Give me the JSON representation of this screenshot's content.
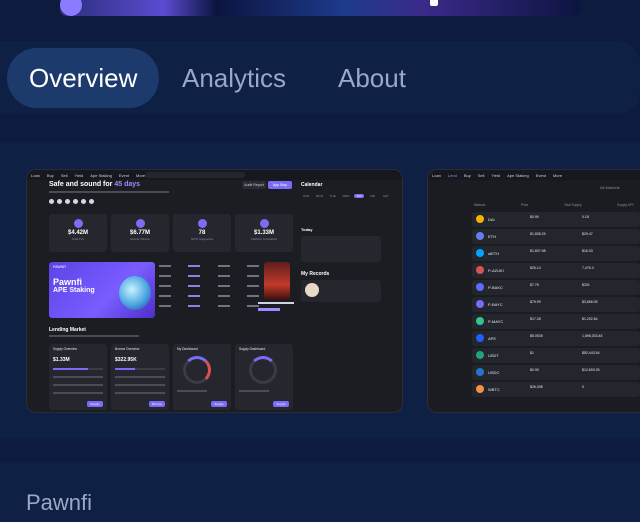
{
  "tabs": [
    {
      "label": "Overview",
      "active": true
    },
    {
      "label": "Analytics",
      "active": false
    },
    {
      "label": "About",
      "active": false
    }
  ],
  "project": {
    "name": "Pawnfi"
  },
  "screenshot_1": {
    "nav": [
      "Loan",
      "Buy",
      "Sell",
      "Yield",
      "Ape Staking",
      "Event",
      "More"
    ],
    "headline": "Safe and sound for",
    "headline_days": "45 days",
    "buttons": {
      "audit": "Audit Report",
      "app": "App Stop"
    },
    "stats": [
      {
        "value": "$4.42M",
        "label": "Total TVL"
      },
      {
        "value": "$6.77M",
        "label": "Assets Volume"
      },
      {
        "value": "78",
        "label": "NFTs Supported"
      },
      {
        "value": "$1.33M",
        "label": "Platform Circulation"
      }
    ],
    "banner": {
      "brand": "PAWNFI",
      "line1": "Pawnfi",
      "line2": "APE Staking"
    },
    "calendar": {
      "title": "Calendar",
      "year": "2023",
      "days": [
        "SUN",
        "MON",
        "TUE",
        "WED",
        "THU",
        "FRI",
        "SAT"
      ],
      "selected": "Thu"
    },
    "today_label": "Today",
    "records_title": "My Records",
    "lending": {
      "title": "Lending Market",
      "cards": [
        {
          "title": "Supply Overview",
          "value": "$1.33M",
          "button": "Supply"
        },
        {
          "title": "Borrow Overview",
          "value": "$322.95K",
          "button": "Borrow"
        },
        {
          "title": "My Dashboard",
          "value": "",
          "button": "Supply"
        },
        {
          "title": "Supply Dashboard",
          "value": "",
          "button": "Supply"
        }
      ]
    }
  },
  "screenshot_2": {
    "nav": [
      "Loan",
      "Lend",
      "Buy",
      "Sell",
      "Yield",
      "Ape Staking",
      "Event",
      "More"
    ],
    "all_markets": "All Markets",
    "columns": [
      "Markets",
      "Price",
      "Total Supply",
      "Supply APY"
    ],
    "rows": [
      {
        "sym": "DAI",
        "price": "$0.99",
        "supply": "0.18",
        "color": "#f5b300"
      },
      {
        "sym": "ETH",
        "price": "$1,838.25",
        "supply": "$29.47",
        "color": "#627eea"
      },
      {
        "sym": "stETH",
        "price": "$1,837.98",
        "supply": "$16.33",
        "color": "#00a3ff"
      },
      {
        "sym": "P-AZUKI",
        "price": "$26.14",
        "supply": "7,476.4",
        "color": "#d9534f"
      },
      {
        "sym": "P-BAKC",
        "price": "$7.78",
        "supply": "$201",
        "color": "#5b6cff"
      },
      {
        "sym": "P-BAYC",
        "price": "$79.99",
        "supply": "$3,666.05",
        "color": "#7b6cf6"
      },
      {
        "sym": "P-MAYC",
        "price": "$17.28",
        "supply": "$1,202.84",
        "color": "#34c38f"
      },
      {
        "sym": "APE",
        "price": "$5.0535",
        "supply": "1,896,033.45",
        "color": "#1f5eff"
      },
      {
        "sym": "USDT",
        "price": "$1",
        "supply": "$52,443.54",
        "color": "#26a17b"
      },
      {
        "sym": "USDC",
        "price": "$0.99",
        "supply": "$12,899.35",
        "color": "#2775ca"
      },
      {
        "sym": "WBTC",
        "price": "$26,398",
        "supply": "0",
        "color": "#f09242"
      }
    ]
  }
}
